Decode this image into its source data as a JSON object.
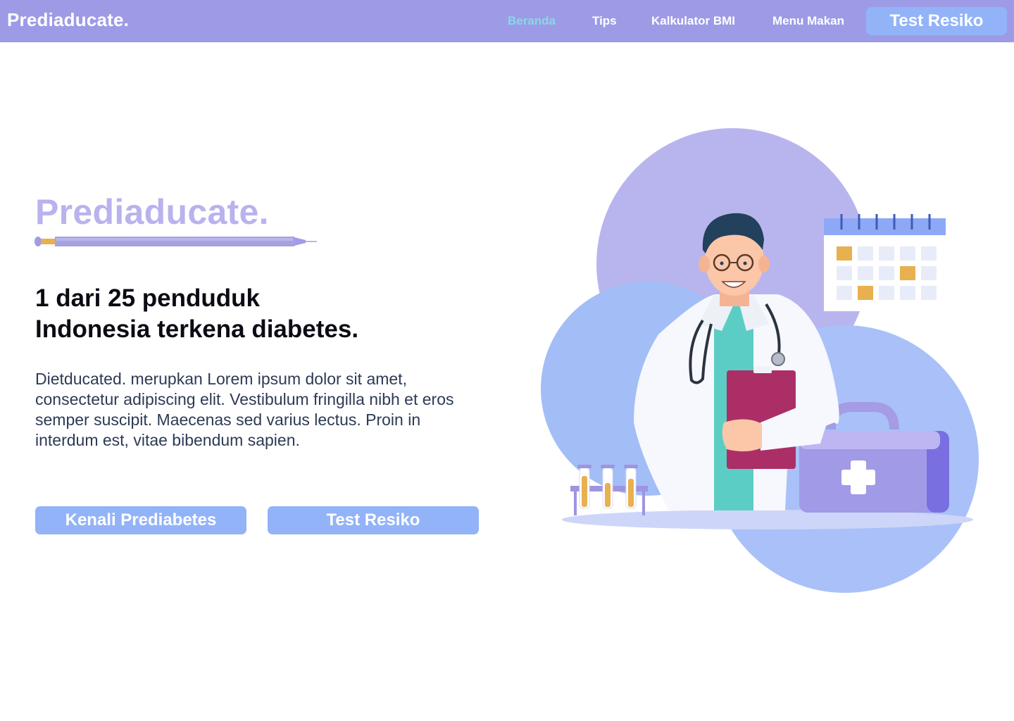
{
  "navbar": {
    "brand": "Prediaducate.",
    "links": [
      {
        "label": "Beranda",
        "active": true
      },
      {
        "label": "Tips",
        "active": false
      },
      {
        "label": "Kalkulator BMI",
        "active": false
      },
      {
        "label": "Menu Makan",
        "active": false
      }
    ],
    "cta_label": "Test Resiko"
  },
  "hero": {
    "brand": "Prediaducate.",
    "headline_line1": "1 dari 25 penduduk",
    "headline_line2": "Indonesia terkena diabetes.",
    "description": "Dietducated. merupkan Lorem ipsum dolor sit amet, consectetur adipiscing elit. Vestibulum fringilla nibh et eros semper suscipit. Maecenas sed varius lectus. Proin in interdum est, vitae bibendum sapien.",
    "button_primary": "Kenali Prediabetes",
    "button_secondary": "Test Resiko"
  },
  "colors": {
    "navbar_bg": "#9d9be6",
    "active_link": "#86d9e4",
    "button_bg": "#93b3f8",
    "brand_light": "#b8b3ee"
  }
}
